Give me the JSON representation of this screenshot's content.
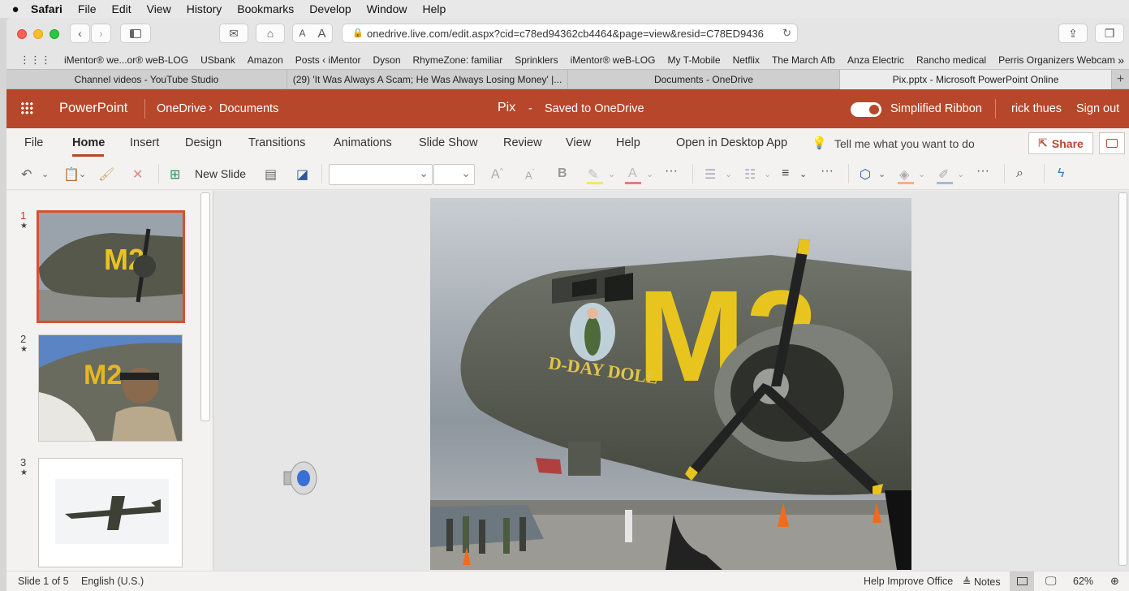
{
  "menubar": {
    "app": "Safari",
    "items": [
      "File",
      "Edit",
      "View",
      "History",
      "Bookmarks",
      "Develop",
      "Window",
      "Help"
    ]
  },
  "browser": {
    "url": "onedrive.live.com/edit.aspx?cid=c78ed94362cb4464&page=view&resid=C78ED9436",
    "font_small": "A",
    "font_large": "A"
  },
  "bookmarks": [
    "iMentor® we...or® weB-LOG",
    "USbank",
    "Amazon",
    "Posts ‹ iMentor",
    "Dyson",
    "RhymeZone: familiar",
    "Sprinklers",
    "iMentor® weB-LOG",
    "My T-Mobile",
    "Netflix",
    "The March Afb",
    "Anza Electric",
    "Rancho medical",
    "Perris Organizers Webcam"
  ],
  "bookmarks_more": "»",
  "tabs": [
    "Channel videos - YouTube Studio",
    "(29) 'It Was Always A Scam; He Was Always Losing Money' |...",
    "Documents - OneDrive",
    "Pix.pptx - Microsoft PowerPoint Online"
  ],
  "tabs_add": "+",
  "header": {
    "app": "PowerPoint",
    "crumb1": "OneDrive",
    "crumb_sep": "›",
    "crumb2": "Documents",
    "file": "Pix",
    "dash": "-",
    "saved": "Saved to OneDrive",
    "toggle_label": "Simplified Ribbon",
    "user": "rick thues",
    "signout": "Sign out"
  },
  "ribbon": {
    "tabs": [
      "File",
      "Home",
      "Insert",
      "Design",
      "Transitions",
      "Animations",
      "Slide Show",
      "Review",
      "View",
      "Help"
    ],
    "open_desktop": "Open in Desktop App",
    "tell_me": "Tell me what you want to do",
    "share": "Share",
    "new_slide": "New Slide",
    "font_grow": "A",
    "font_shrink": "A",
    "bold": "B",
    "more": "···"
  },
  "slides": [
    {
      "num": "1",
      "star": "★"
    },
    {
      "num": "2",
      "star": "★"
    },
    {
      "num": "3",
      "star": "★"
    }
  ],
  "status": {
    "slide": "Slide 1 of 5",
    "lang": "English (U.S.)",
    "help": "Help Improve Office",
    "notes": "Notes",
    "zoom": "62%"
  },
  "colors": {
    "accent": "#b7472a",
    "selected": "#d35230"
  }
}
